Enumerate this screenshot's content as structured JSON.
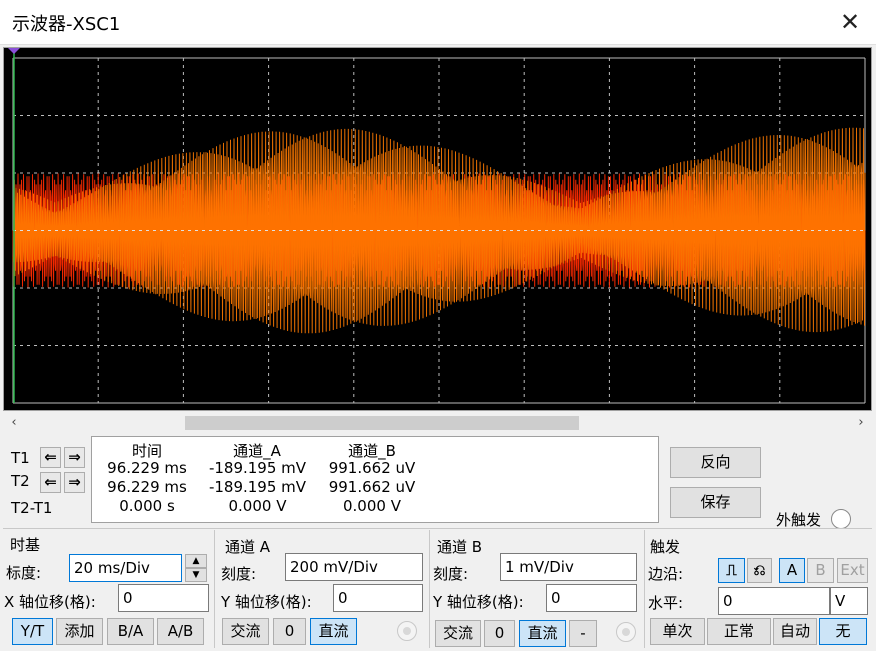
{
  "window": {
    "title": "示波器-XSC1",
    "close_icon": "close-icon"
  },
  "colors": {
    "screen_bg": "#000000",
    "grid": "#bdbdbd",
    "trace_a": "#ff7a00",
    "trace_b": "#ff2a00",
    "accent": "#0078d7"
  },
  "scope": {
    "signal_description": "AM-like amplitude-modulated waveform",
    "channel_a_trace": "orange",
    "channel_b_trace": "red"
  },
  "cursors": {
    "t1_label": "T1",
    "t2_label": "T2",
    "diff_label": "T2-T1"
  },
  "readout": {
    "headers": [
      "时间",
      "通道_A",
      "通道_B"
    ],
    "rows": [
      [
        "96.229 ms",
        "-189.195 mV",
        "991.662 uV"
      ],
      [
        "96.229 ms",
        "-189.195 mV",
        "991.662 uV"
      ],
      [
        "0.000 s",
        "0.000 V",
        "0.000 V"
      ]
    ]
  },
  "buttons": {
    "reverse": "反向",
    "save": "保存",
    "ext_trigger": "外触发"
  },
  "timebase": {
    "title": "时基",
    "scale_label": "标度:",
    "scale_value": "20 ms/Div",
    "xpos_label": "X 轴位移(格):",
    "xpos_value": "0",
    "modes": [
      "Y/T",
      "添加",
      "B/A",
      "A/B"
    ]
  },
  "channel_a": {
    "title": "通道 A",
    "scale_label": "刻度:",
    "scale_value": "200 mV/Div",
    "ypos_label": "Y 轴位移(格):",
    "ypos_value": "0",
    "coupling": [
      "交流",
      "0",
      "直流"
    ]
  },
  "channel_b": {
    "title": "通道 B",
    "scale_label": "刻度:",
    "scale_value": "1 mV/Div",
    "ypos_label": "Y 轴位移(格):",
    "ypos_value": "0",
    "coupling": [
      "交流",
      "0",
      "直流",
      "-"
    ]
  },
  "trigger": {
    "title": "触发",
    "edge_label": "边沿:",
    "level_label": "水平:",
    "level_value": "0",
    "level_unit": "V",
    "sources": [
      "A",
      "B",
      "Ext"
    ],
    "modes": [
      "单次",
      "正常",
      "自动",
      "无"
    ]
  }
}
